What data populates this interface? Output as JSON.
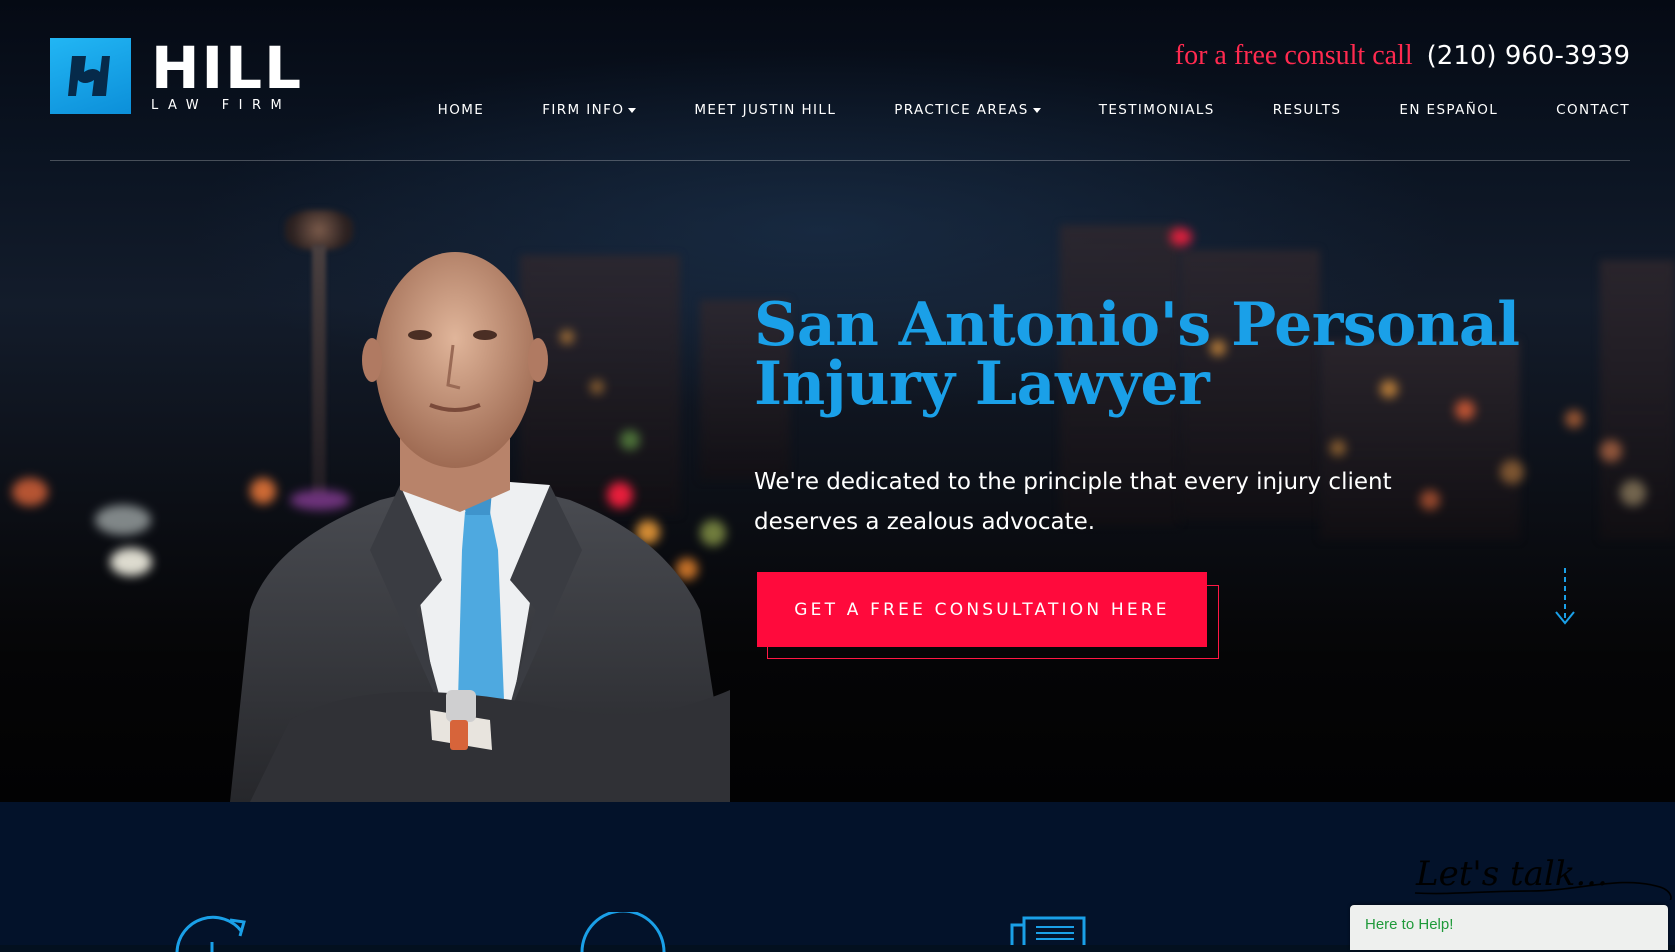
{
  "brand": {
    "name": "HILL",
    "subtitle": "LAW FIRM",
    "accent_color": "#1aa0e8",
    "cta_color": "#ff0a3c"
  },
  "header": {
    "call_label": "for a free consult call",
    "phone": "(210) 960-3939"
  },
  "nav": {
    "items": [
      {
        "label": "HOME",
        "dropdown": false
      },
      {
        "label": "FIRM INFO",
        "dropdown": true
      },
      {
        "label": "MEET JUSTIN HILL",
        "dropdown": false
      },
      {
        "label": "PRACTICE AREAS",
        "dropdown": true
      },
      {
        "label": "TESTIMONIALS",
        "dropdown": false
      },
      {
        "label": "RESULTS",
        "dropdown": false
      },
      {
        "label": "EN ESPAÑOL",
        "dropdown": false
      },
      {
        "label": "CONTACT",
        "dropdown": false
      }
    ]
  },
  "hero": {
    "title_line1": "San Antonio's Personal",
    "title_line2": "Injury Lawyer",
    "subtitle_line1": "We're dedicated to the principle that every injury client",
    "subtitle_line2": "deserves a zealous advocate.",
    "cta_label": "GET A FREE CONSULTATION HERE",
    "scroll_icon": "arrow-down-icon"
  },
  "features": {
    "icons": [
      "clock-icon",
      "circle-icon",
      "newspaper-icon"
    ]
  },
  "chat": {
    "script_label": "Let's talk...",
    "widget_label": "Here to Help!"
  }
}
